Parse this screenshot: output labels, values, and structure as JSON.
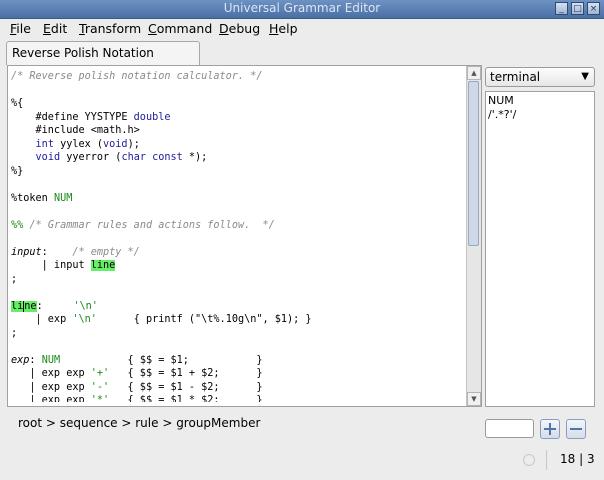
{
  "window": {
    "title": "Universal Grammar Editor",
    "controls": {
      "minimize": "_",
      "maximize": "□",
      "close": "×"
    }
  },
  "menubar": {
    "items": [
      {
        "label": "File",
        "accel": "F",
        "rest": "ile"
      },
      {
        "label": "Edit",
        "accel": "E",
        "rest": "dit"
      },
      {
        "label": "Transform",
        "accel": "T",
        "rest": "ransform"
      },
      {
        "label": "Command",
        "accel": "C",
        "rest": "ommand"
      },
      {
        "label": "Debug",
        "accel": "D",
        "rest": "ebug"
      },
      {
        "label": "Help",
        "accel": "H",
        "rest": "elp"
      }
    ]
  },
  "tabs": [
    {
      "label": "Reverse Polish Notation Calculator"
    }
  ],
  "editor": {
    "lines": [
      [
        {
          "t": "/* Reverse polish notation calculator. */",
          "c": "cm"
        }
      ],
      [],
      [
        {
          "t": "%{",
          "c": ""
        }
      ],
      [
        {
          "t": "    #define YYSTYPE ",
          "c": ""
        },
        {
          "t": "double",
          "c": "kw"
        }
      ],
      [
        {
          "t": "    #include <math.h>",
          "c": ""
        }
      ],
      [
        {
          "t": "    ",
          "c": ""
        },
        {
          "t": "int",
          "c": "kw"
        },
        {
          "t": " yylex (",
          "c": ""
        },
        {
          "t": "void",
          "c": "kw"
        },
        {
          "t": ");",
          "c": ""
        }
      ],
      [
        {
          "t": "    ",
          "c": ""
        },
        {
          "t": "void",
          "c": "kw"
        },
        {
          "t": " yyerror (",
          "c": ""
        },
        {
          "t": "char const",
          "c": "kw"
        },
        {
          "t": " *);",
          "c": ""
        }
      ],
      [
        {
          "t": "%}",
          "c": ""
        }
      ],
      [],
      [
        {
          "t": "%token ",
          "c": ""
        },
        {
          "t": "NUM",
          "c": "gr"
        }
      ],
      [],
      [
        {
          "t": "%%",
          "c": "gr"
        },
        {
          "t": " /* Grammar rules and actions follow.  */",
          "c": "cm"
        }
      ],
      [],
      [
        {
          "t": "input",
          "c": "it"
        },
        {
          "t": ":    ",
          "c": ""
        },
        {
          "t": "/* empty */",
          "c": "cm"
        }
      ],
      [
        {
          "t": "     | input ",
          "c": ""
        },
        {
          "t": "line",
          "c": "hl"
        }
      ],
      [
        {
          "t": ";",
          "c": ""
        }
      ],
      [],
      [
        {
          "t": "li",
          "c": "hl"
        },
        {
          "t": "",
          "c": "caret"
        },
        {
          "t": "ne",
          "c": "hl"
        },
        {
          "t": ":     ",
          "c": ""
        },
        {
          "t": "'\\n'",
          "c": "gr"
        }
      ],
      [
        {
          "t": "    | exp ",
          "c": ""
        },
        {
          "t": "'\\n'",
          "c": "gr"
        },
        {
          "t": "      { printf (\"\\t%.10g\\n\", $1); }",
          "c": ""
        }
      ],
      [
        {
          "t": ";",
          "c": ""
        }
      ],
      [],
      [
        {
          "t": "exp",
          "c": "it"
        },
        {
          "t": ": ",
          "c": ""
        },
        {
          "t": "NUM",
          "c": "gr"
        },
        {
          "t": "           { $$ = $1;           }",
          "c": ""
        }
      ],
      [
        {
          "t": "   | exp exp ",
          "c": ""
        },
        {
          "t": "'+'",
          "c": "gr"
        },
        {
          "t": "   { $$ = $1 + $2;      }",
          "c": ""
        }
      ],
      [
        {
          "t": "   | exp exp ",
          "c": ""
        },
        {
          "t": "'-'",
          "c": "gr"
        },
        {
          "t": "   { $$ = $1 - $2;      }",
          "c": ""
        }
      ],
      [
        {
          "t": "   | exp exp ",
          "c": ""
        },
        {
          "t": "'*'",
          "c": "gr"
        },
        {
          "t": "   { $$ = $1 * $2;      }",
          "c": ""
        }
      ]
    ]
  },
  "breadcrumb": "root > sequence > rule > groupMember",
  "side_panel": {
    "select_value": "terminal",
    "items": [
      "NUM",
      "/'.*?'/"
    ]
  },
  "status": {
    "position": "18 | 3"
  },
  "icons": {
    "add": "plus-icon",
    "remove": "minus-icon",
    "dropdown": "chevron-down-icon",
    "status": "status-circle-icon"
  },
  "colors": {
    "titlebar": "#4a6fa5",
    "comment": "#8a8a8a",
    "keyword": "#1d1d9c",
    "terminal": "#1a8a1a",
    "highlight": "#66ee66",
    "button_glyph": "#4f74a8"
  }
}
